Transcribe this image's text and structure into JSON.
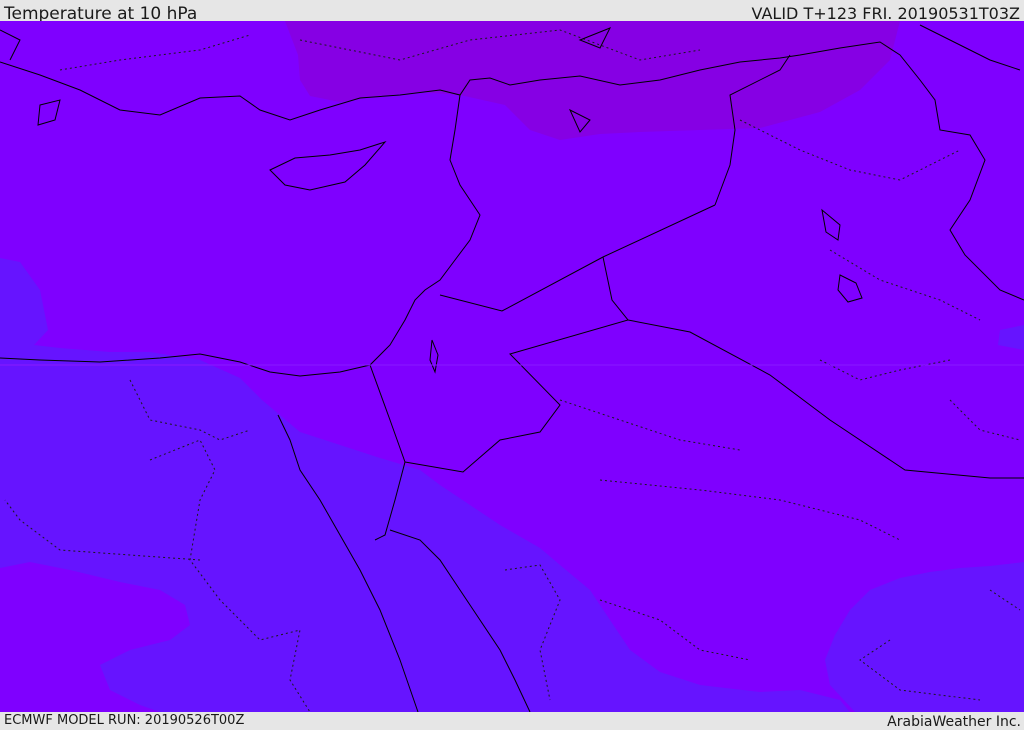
{
  "header": {
    "title": "Temperature at 10 hPa",
    "valid": "VALID T+123 FRI. 20190531T03Z"
  },
  "footer": {
    "model_run": "ECMWF MODEL RUN: 20190526T00Z",
    "credit": "ArabiaWeather Inc."
  },
  "colors": {
    "band_cold": "#7f00ff",
    "band_colder": "#8600e4",
    "band_warm": "#6614ff",
    "coastline": "#000000",
    "border_dotted": "#1a1a1a",
    "bar_background": "#e6e6e6"
  }
}
